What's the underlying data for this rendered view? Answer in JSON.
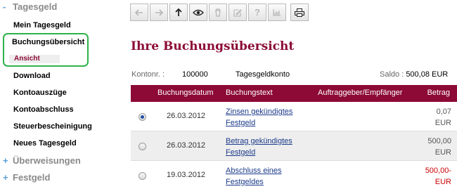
{
  "sidebar": {
    "groups": [
      {
        "label": "Tagesgeld",
        "prefix": "-"
      },
      {
        "label": "Überweisungen",
        "prefix": "+"
      },
      {
        "label": "Festgeld",
        "prefix": "+"
      }
    ],
    "items": [
      {
        "label": "Mein Tagesgeld"
      },
      {
        "label": "Buchungsübersicht"
      },
      {
        "label": "Download"
      },
      {
        "label": "Kontoauszüge"
      },
      {
        "label": "Kontoabschluss"
      },
      {
        "label": "Steuerbescheinigung"
      },
      {
        "label": "Neues Tagesgeld"
      }
    ],
    "active_sub_item": "Ansicht",
    "highlight_color": "#2eb24a"
  },
  "toolbar": {
    "buttons": [
      {
        "icon": "arrow-left-icon",
        "enabled": false
      },
      {
        "icon": "arrow-right-icon",
        "enabled": false
      },
      {
        "icon": "arrow-up-icon",
        "enabled": true
      },
      {
        "icon": "eye-icon",
        "enabled": true
      },
      {
        "icon": "trash-icon",
        "enabled": false
      },
      {
        "icon": "edit-icon",
        "enabled": false
      },
      {
        "icon": "help-icon",
        "enabled": false
      },
      {
        "icon": "bar-chart-icon",
        "enabled": false
      },
      {
        "icon": "print-icon",
        "enabled": true
      }
    ]
  },
  "page": {
    "title": "Ihre Buchungsübersicht",
    "brand_color": "#8c0a35"
  },
  "account": {
    "number_label": "Kontonr. :",
    "number": "100000",
    "type": "Tagesgeldkonto",
    "balance_label": "Saldo :",
    "balance": "500,08 EUR"
  },
  "table": {
    "columns": [
      "Buchungsdatum",
      "Buchungstext",
      "Auftraggeber/Empfänger",
      "Betrag"
    ],
    "rows": [
      {
        "selected": true,
        "date": "26.03.2012",
        "text_line1": "Zinsen gekündigtes",
        "text_line2": "Festgeld",
        "amount": "0,07",
        "currency": "EUR",
        "negative": false
      },
      {
        "selected": false,
        "date": "26.03.2012",
        "text_line1": "Betrag gekündigtes",
        "text_line2": "Festgeld",
        "amount": "500,00",
        "currency": "EUR",
        "negative": false
      },
      {
        "selected": false,
        "date": "19.03.2012",
        "text_line1": "Abschluss eines",
        "text_line2": "Festgeldes",
        "amount": "500,00-",
        "currency": "EUR",
        "negative": true
      }
    ]
  }
}
